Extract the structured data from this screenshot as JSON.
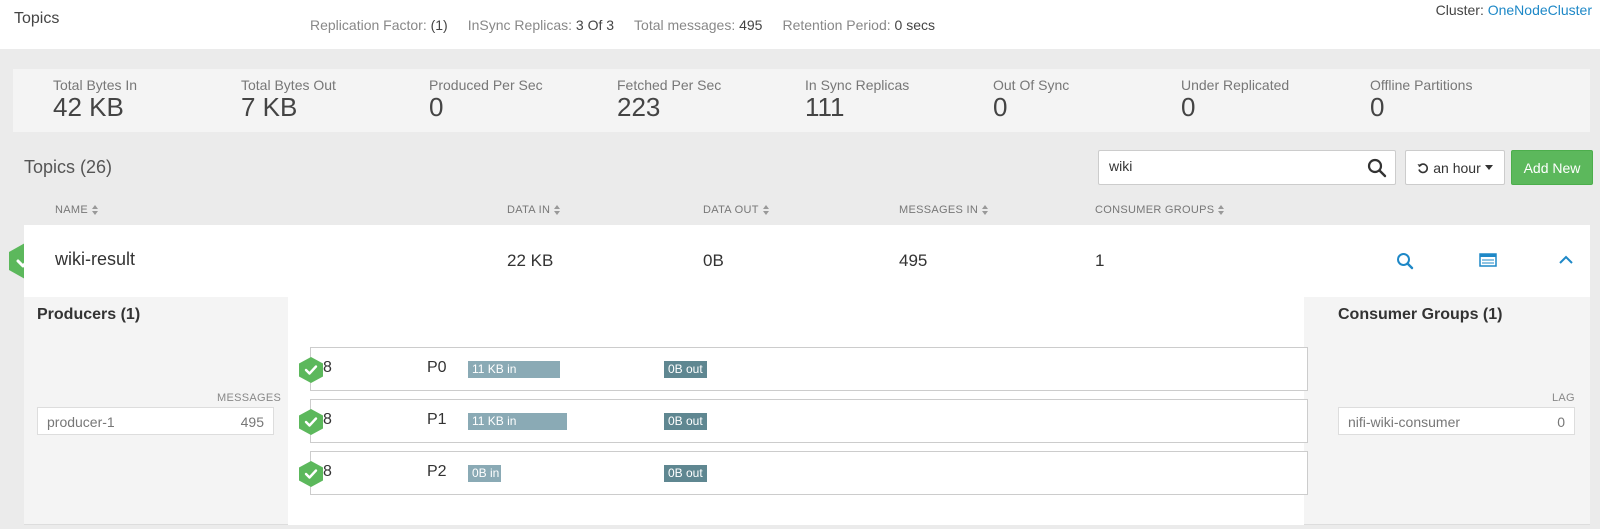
{
  "header": {
    "title": "Topics",
    "cluster_label": "Cluster:",
    "cluster_name": "OneNodeCluster"
  },
  "metrics": [
    {
      "label": "Total Bytes In",
      "value": "42 KB"
    },
    {
      "label": "Total Bytes Out",
      "value": "7 KB"
    },
    {
      "label": "Produced Per Sec",
      "value": "0"
    },
    {
      "label": "Fetched Per Sec",
      "value": "223"
    },
    {
      "label": "In Sync Replicas",
      "value": "111"
    },
    {
      "label": "Out Of Sync",
      "value": "0"
    },
    {
      "label": "Under Replicated",
      "value": "0"
    },
    {
      "label": "Offline Partitions",
      "value": "0"
    }
  ],
  "toolbar": {
    "topics_title": "Topics (26)",
    "search_value": "wiki",
    "time_range": "an hour",
    "add_label": "Add New"
  },
  "columns": {
    "name": "NAME",
    "data_in": "DATA IN",
    "data_out": "DATA OUT",
    "messages_in": "MESSAGES IN",
    "consumer_groups": "CONSUMER GROUPS"
  },
  "topic": {
    "name": "wiki-result",
    "data_in": "22 KB",
    "data_out": "0B",
    "messages_in": "495",
    "consumer_groups": "1"
  },
  "details": {
    "producers_title": "Producers (1)",
    "messages_head": "MESSAGES",
    "producers": [
      {
        "name": "producer-1",
        "value": "495"
      }
    ],
    "replication_label": "Replication Factor:",
    "replication_value": "(1)",
    "insync_label": "InSync Replicas:",
    "insync_value": "3 Of 3",
    "total_label": "Total messages:",
    "total_value": "495",
    "retention_label": "Retention Period:",
    "retention_value": "0 secs",
    "partitions": [
      {
        "broker": "8",
        "id": "P0",
        "in": "11 KB in",
        "out": "0B out"
      },
      {
        "broker": "8",
        "id": "P1",
        "in": "11 KB in",
        "out": "0B out"
      },
      {
        "broker": "8",
        "id": "P2",
        "in": "0B in",
        "out": "0B out"
      }
    ],
    "consumers_title": "Consumer Groups (1)",
    "lag_head": "LAG",
    "consumers": [
      {
        "name": "nifi-wiki-consumer",
        "value": "0"
      }
    ]
  },
  "colors": {
    "accent": "#1e88c7",
    "success": "#5cb85c",
    "bar_in": "#8aaab5",
    "bar_out": "#5f8791"
  }
}
